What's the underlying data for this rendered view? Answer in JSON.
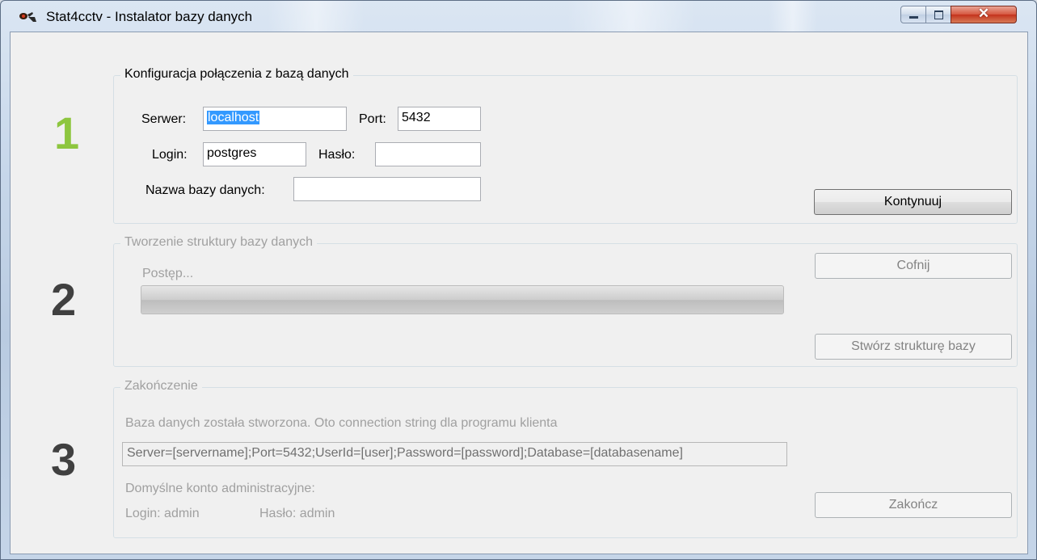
{
  "window": {
    "title": "Stat4cctv - Instalator bazy danych",
    "controls": {
      "minimize": "minimize-icon",
      "maximize": "maximize-icon",
      "close": "close-icon"
    }
  },
  "step1": {
    "number": "1",
    "number_color": "#8dc63f",
    "group_title": "Konfiguracja połączenia z bazą danych",
    "server_label": "Serwer:",
    "server_value": "localhost",
    "port_label": "Port:",
    "port_value": "5432",
    "login_label": "Login:",
    "login_value": "postgres",
    "password_label": "Hasło:",
    "password_value": "",
    "dbname_label": "Nazwa bazy danych:",
    "dbname_value": "",
    "continue_button": "Kontynuuj"
  },
  "step2": {
    "number": "2",
    "number_color": "#404040",
    "group_title": "Tworzenie struktury bazy danych",
    "progress_label": "Postęp...",
    "progress": 0,
    "back_button": "Cofnij",
    "create_button": "Stwórz strukturę bazy"
  },
  "step3": {
    "number": "3",
    "number_color": "#404040",
    "group_title": "Zakończenie",
    "info_text": "Baza danych została stworzona. Oto connection string dla programu klienta",
    "connection_string": "Server=[servername];Port=5432;UserId=[user];Password=[password];Database=[databasename]",
    "admin_title": "Domyślne konto administracyjne:",
    "admin_login": "Login: admin",
    "admin_password": "Hasło: admin",
    "finish_button": "Zakończ"
  }
}
